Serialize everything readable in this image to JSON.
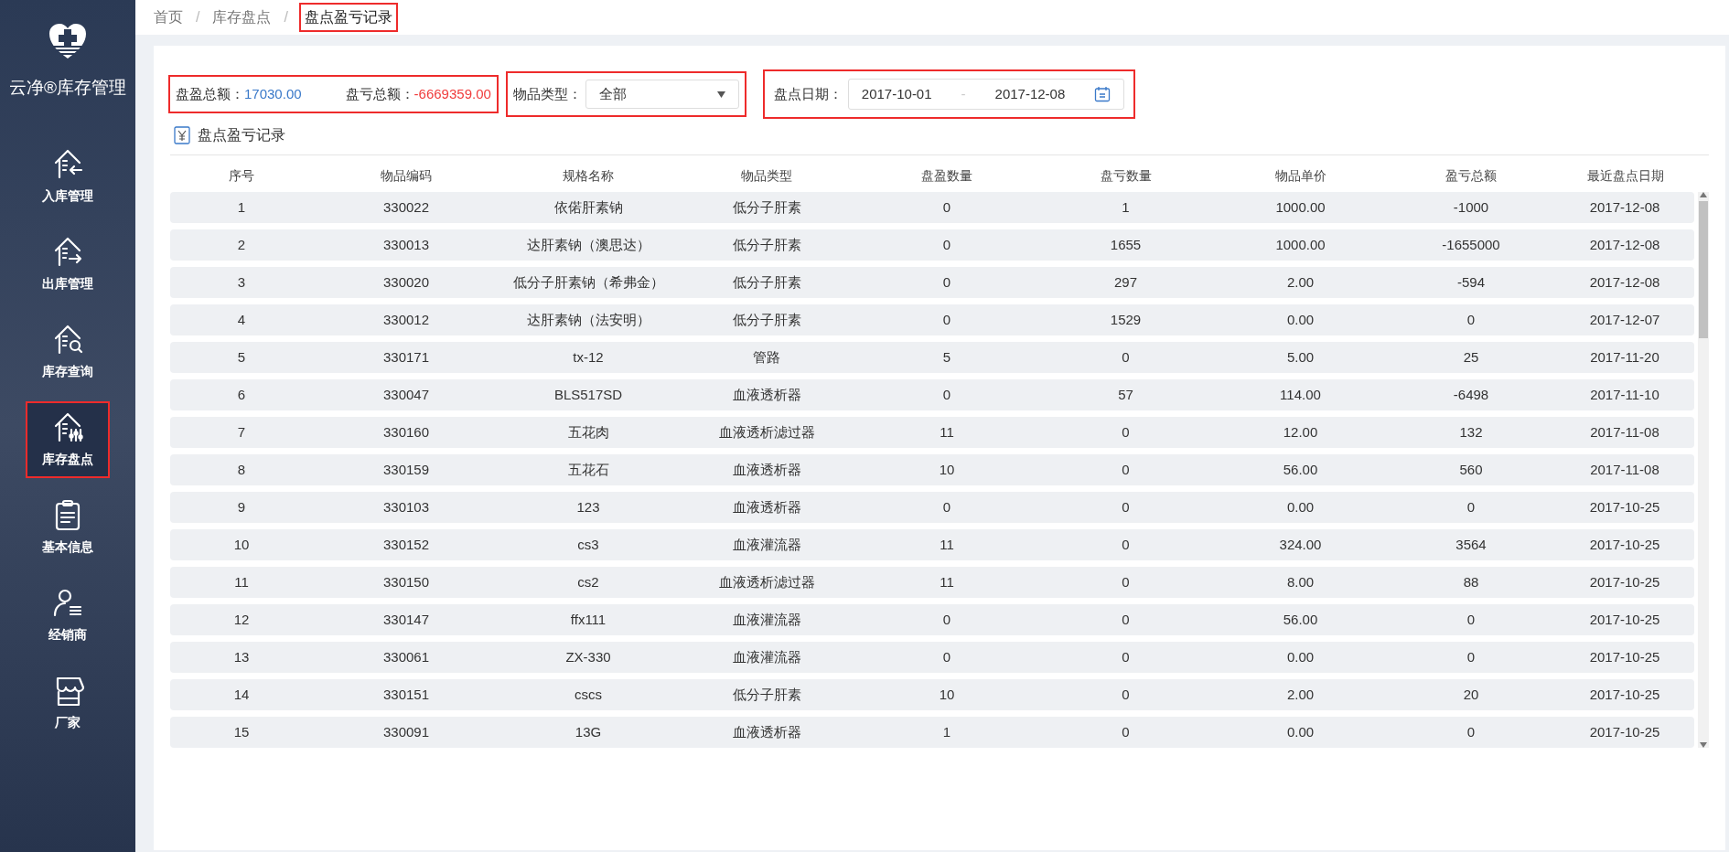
{
  "brand": {
    "title": "云净®库存管理"
  },
  "sidebar": {
    "items": [
      {
        "label": "入库管理",
        "selected": false,
        "highlighted": false
      },
      {
        "label": "出库管理",
        "selected": false,
        "highlighted": false
      },
      {
        "label": "库存查询",
        "selected": false,
        "highlighted": false
      },
      {
        "label": "库存盘点",
        "selected": true,
        "highlighted": true
      },
      {
        "label": "基本信息",
        "selected": false,
        "highlighted": false
      },
      {
        "label": "经销商",
        "selected": false,
        "highlighted": false
      },
      {
        "label": "厂家",
        "selected": false,
        "highlighted": false
      }
    ]
  },
  "breadcrumb": [
    {
      "label": "首页",
      "highlighted": false
    },
    {
      "label": "库存盘点",
      "highlighted": false
    },
    {
      "label": "盘点盈亏记录",
      "highlighted": true
    }
  ],
  "breadcrumb_separator": "/",
  "summary": {
    "highlighted": true,
    "gain_label": "盘盈总额：",
    "gain_value": "17030.00",
    "loss_label": "盘亏总额：",
    "loss_value": "-6669359.00"
  },
  "type_filter": {
    "highlighted": true,
    "label": "物品类型：",
    "value": "全部"
  },
  "date_filter": {
    "highlighted": true,
    "label": "盘点日期：",
    "start": "2017-10-01",
    "separator": "-",
    "end": "2017-12-08"
  },
  "section_title": "盘点盈亏记录",
  "table": {
    "columns": [
      "序号",
      "物品编码",
      "规格名称",
      "物品类型",
      "盘盈数量",
      "盘亏数量",
      "物品单价",
      "盈亏总额",
      "最近盘点日期"
    ],
    "rows": [
      [
        "1",
        "330022",
        "依偌肝素钠",
        "低分子肝素",
        "0",
        "1",
        "1000.00",
        "-1000",
        "2017-12-08"
      ],
      [
        "2",
        "330013",
        "达肝素钠（澳思达）",
        "低分子肝素",
        "0",
        "1655",
        "1000.00",
        "-1655000",
        "2017-12-08"
      ],
      [
        "3",
        "330020",
        "低分子肝素钠（希弗金）",
        "低分子肝素",
        "0",
        "297",
        "2.00",
        "-594",
        "2017-12-08"
      ],
      [
        "4",
        "330012",
        "达肝素钠（法安明）",
        "低分子肝素",
        "0",
        "1529",
        "0.00",
        "0",
        "2017-12-07"
      ],
      [
        "5",
        "330171",
        "tx-12",
        "管路",
        "5",
        "0",
        "5.00",
        "25",
        "2017-11-20"
      ],
      [
        "6",
        "330047",
        "BLS517SD",
        "血液透析器",
        "0",
        "57",
        "114.00",
        "-6498",
        "2017-11-10"
      ],
      [
        "7",
        "330160",
        "五花肉",
        "血液透析滤过器",
        "11",
        "0",
        "12.00",
        "132",
        "2017-11-08"
      ],
      [
        "8",
        "330159",
        "五花石",
        "血液透析器",
        "10",
        "0",
        "56.00",
        "560",
        "2017-11-08"
      ],
      [
        "9",
        "330103",
        "123",
        "血液透析器",
        "0",
        "0",
        "0.00",
        "0",
        "2017-10-25"
      ],
      [
        "10",
        "330152",
        "cs3",
        "血液灌流器",
        "11",
        "0",
        "324.00",
        "3564",
        "2017-10-25"
      ],
      [
        "11",
        "330150",
        "cs2",
        "血液透析滤过器",
        "11",
        "0",
        "8.00",
        "88",
        "2017-10-25"
      ],
      [
        "12",
        "330147",
        "ffx111",
        "血液灌流器",
        "0",
        "0",
        "56.00",
        "0",
        "2017-10-25"
      ],
      [
        "13",
        "330061",
        "ZX-330",
        "血液灌流器",
        "0",
        "0",
        "0.00",
        "0",
        "2017-10-25"
      ],
      [
        "14",
        "330151",
        "cscs",
        "低分子肝素",
        "10",
        "0",
        "2.00",
        "20",
        "2017-10-25"
      ],
      [
        "15",
        "330091",
        "13G",
        "血液透析器",
        "1",
        "0",
        "0.00",
        "0",
        "2017-10-25"
      ]
    ]
  }
}
